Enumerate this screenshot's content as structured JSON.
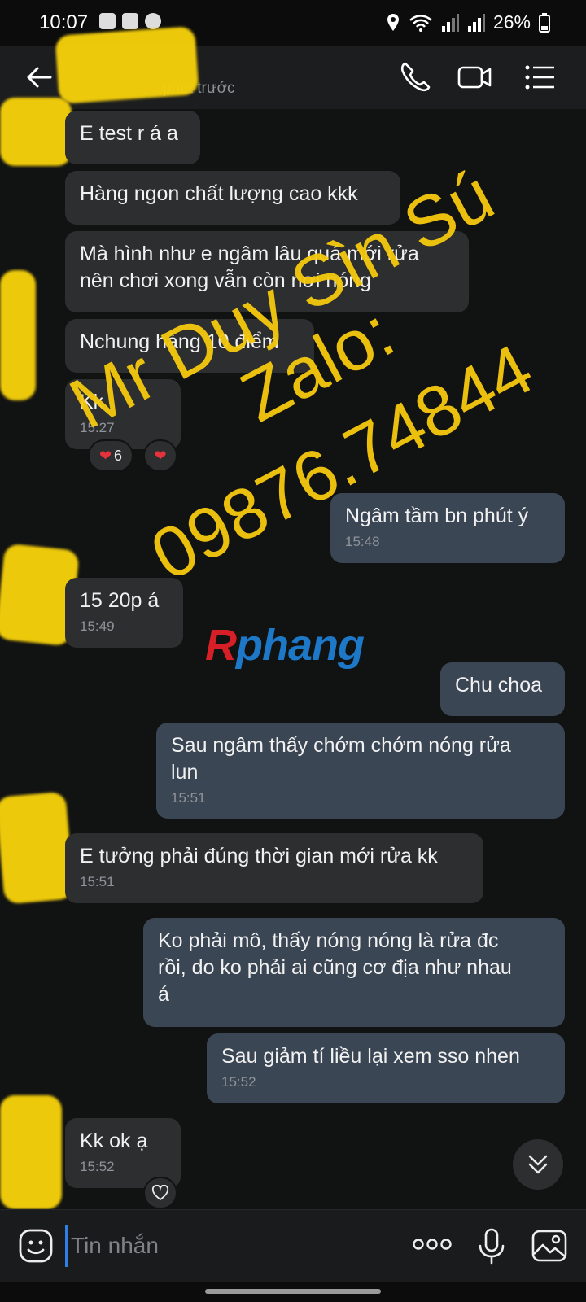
{
  "status_bar": {
    "time": "10:07",
    "battery": "26%"
  },
  "header": {
    "subtitle": "phút trước"
  },
  "messages": [
    {
      "text": "E test r á a",
      "time": ""
    },
    {
      "text": "Hàng ngon chất lượng cao kkk",
      "time": ""
    },
    {
      "text": "Mà hình như e ngâm lâu quá mới rửa nên chơi xong vẫn còn nơi nóng",
      "line1": "Mà hình như e ngâm lâu quá mới rửa",
      "line2": "nên chơi xong vẫn còn nơi nóng",
      "time": ""
    },
    {
      "text": "Nchung hàng 10 điểm",
      "time": ""
    },
    {
      "text": "Kk",
      "time": "15:27"
    },
    {
      "text": "Ngâm tầm bn phút ý",
      "time": "15:48"
    },
    {
      "text": "15 20p á",
      "time": "15:49"
    },
    {
      "text": "Chu choa",
      "time": ""
    },
    {
      "text": "Sau ngâm thấy chớm chớm nóng rửa lun",
      "line1": "Sau ngâm thấy chớm chớm nóng rửa",
      "line2": "lun",
      "time": "15:51"
    },
    {
      "text": "E tưởng phải đúng thời gian mới rửa kk",
      "time": "15:51"
    },
    {
      "text": "Ko phải mô, thấy nóng nóng là rửa đc rồi, do ko phải ai cũng cơ địa như nhau á",
      "line1": "Ko phải mô, thấy nóng nóng là rửa đc",
      "line2": "rồi, do ko phải ai cũng cơ địa như nhau",
      "line3": "á",
      "time": ""
    },
    {
      "text": "Sau giảm tí liều lại xem sso nhen",
      "time": "15:52"
    },
    {
      "text": "Kk ok ạ",
      "time": "15:52"
    }
  ],
  "reactions": {
    "heart_count": "6"
  },
  "watermark": {
    "line1": "Mr Duy Sìn Sú",
    "line2": "Zalo:",
    "line3": "09876.74844"
  },
  "logo": {
    "r": "R",
    "rest": "phang"
  },
  "composer": {
    "placeholder": "Tin nhắn"
  },
  "colors": {
    "incoming": "#2d2e30",
    "outgoing": "#3b4654",
    "watermark": "#f6c90e",
    "accent": "#2f7fe6"
  }
}
